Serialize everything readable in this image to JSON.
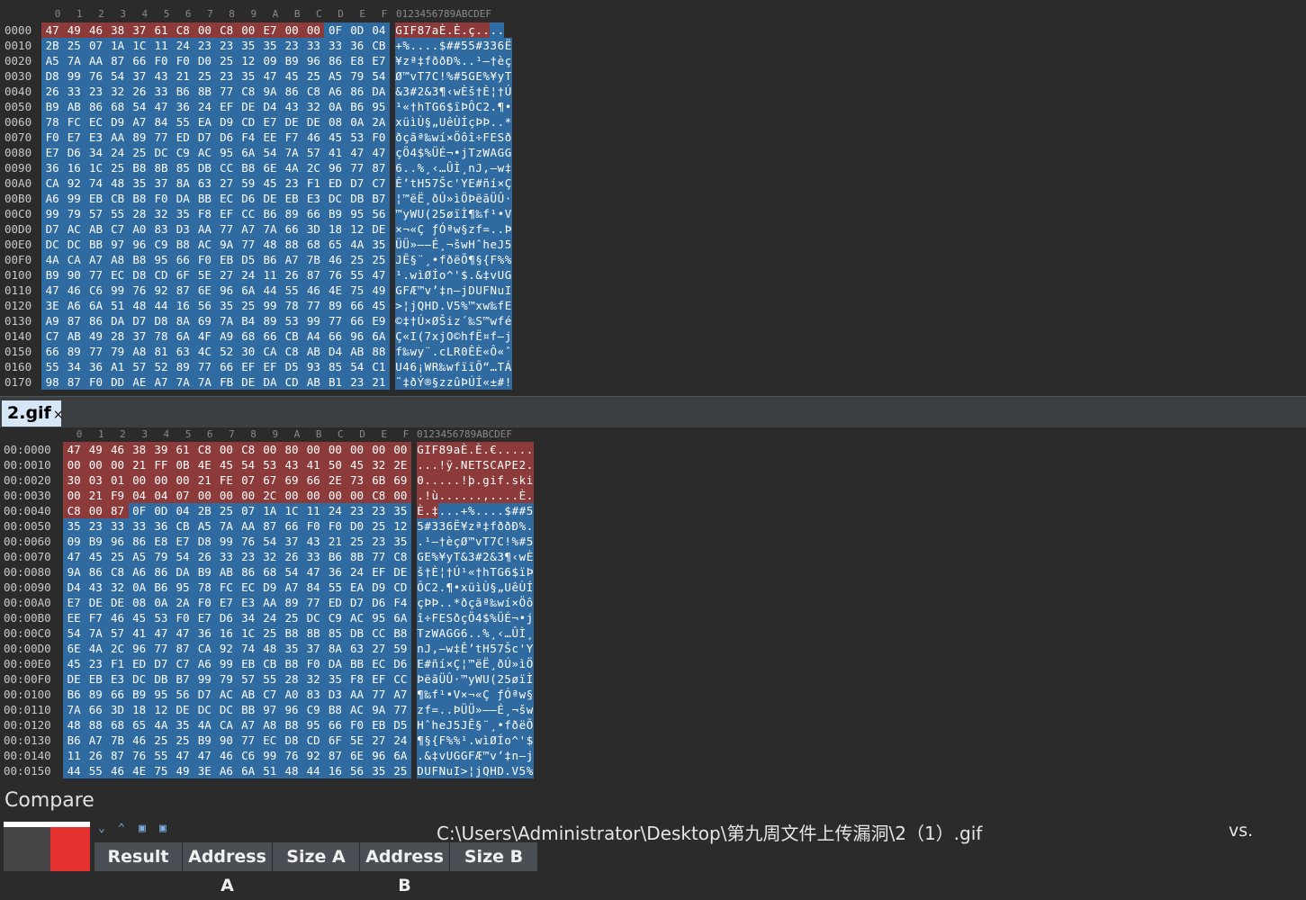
{
  "top_pane": {
    "col_header": "0 1 2 3 4 5 6 7 8 9 A B C D E F",
    "ascii_header": "0123456789ABCDEF",
    "rows": [
      {
        "off": "0000",
        "hex": "47 49 46 38 37 61 C8 00 C8 00 E7 00 00 0F 0D 04",
        "asc": "GIF87aÈ.È.ç....",
        "red": 13
      },
      {
        "off": "0010",
        "hex": "2B 25 07 1A 1C 11 24 23 23 35 35 23 33 33 36 CB",
        "asc": "+%....$##55#336Ë",
        "red": 0
      },
      {
        "off": "0020",
        "hex": "A5 7A AA 87 66 F0 F0 D0 25 12 09 B9 96 86 E8 E7",
        "asc": "¥zª‡fððÐ%..¹–†èç",
        "red": 0
      },
      {
        "off": "0030",
        "hex": "D8 99 76 54 37 43 21 25 23 35 47 45 25 A5 79 54",
        "asc": "Ø™vT7C!%#5GE%¥yT",
        "red": 0
      },
      {
        "off": "0040",
        "hex": "26 33 23 32 26 33 B6 8B 77 C8 9A 86 C8 A6 86 DA",
        "asc": "&3#2&3¶‹wÈš†È¦†Ú",
        "red": 0
      },
      {
        "off": "0050",
        "hex": "B9 AB 86 68 54 47 36 24 EF DE D4 43 32 0A B6 95",
        "asc": "¹«†hTG6$ïÞÔC2.¶•",
        "red": 0
      },
      {
        "off": "0060",
        "hex": "78 FC EC D9 A7 84 55 EA D9 CD E7 DE DE 08 0A 2A",
        "asc": "xüìÙ§„UêÙÍçÞÞ..*",
        "red": 0
      },
      {
        "off": "0070",
        "hex": "F0 E7 E3 AA 89 77 ED D7 D6 F4 EE F7 46 45 53 F0",
        "asc": "ðçãª‰wí×Öôî÷FESð",
        "red": 0
      },
      {
        "off": "0080",
        "hex": "E7 D6 34 24 25 DC C9 AC 95 6A 54 7A 57 41 47 47",
        "asc": "çÖ4$%ÜÉ¬•jTzWAGG",
        "red": 0
      },
      {
        "off": "0090",
        "hex": "36 16 1C 25 B8 8B 85 DB CC B8 6E 4A 2C 96 77 87",
        "asc": "6..%¸‹…ÛÌ¸nJ,–w‡",
        "red": 0
      },
      {
        "off": "00A0",
        "hex": "CA 92 74 48 35 37 8A 63 27 59 45 23 F1 ED D7 C7",
        "asc": "Ê’tH57Šc'YE#ñí×Ç",
        "red": 0
      },
      {
        "off": "00B0",
        "hex": "A6 99 EB CB B8 F0 DA BB EC D6 DE EB E3 DC DB B7",
        "asc": "¦™ëË¸ðÚ»ìÖÞëãÜÛ·",
        "red": 0
      },
      {
        "off": "00C0",
        "hex": "99 79 57 55 28 32 35 F8 EF CC B6 89 66 B9 95 56",
        "asc": "™yWU(25øïÌ¶‰f¹•V",
        "red": 0
      },
      {
        "off": "00D0",
        "hex": "D7 AC AB C7 A0 83 D3 AA 77 A7 7A 66 3D 18 12 DE",
        "asc": "×¬«Ç ƒÓªw§zf=..Þ",
        "red": 0
      },
      {
        "off": "00E0",
        "hex": "DC DC BB 97 96 C9 B8 AC 9A 77 48 88 68 65 4A 35",
        "asc": "ÜÜ»—–É¸¬šwHˆheJ5",
        "red": 0
      },
      {
        "off": "00F0",
        "hex": "4A CA A7 A8 B8 95 66 F0 EB D5 B6 A7 7B 46 25 25",
        "asc": "JÊ§¨¸•fðëÕ¶§{F%%",
        "red": 0
      },
      {
        "off": "0100",
        "hex": "B9 90 77 EC D8 CD 6F 5E 27 24 11 26 87 76 55 47",
        "asc": "¹.wìØÍo^'$.&‡vUG",
        "red": 0
      },
      {
        "off": "0110",
        "hex": "47 46 C6 99 76 92 87 6E 96 6A 44 55 46 4E 75 49",
        "asc": "GFÆ™v’‡n–jDUFNuI",
        "red": 0
      },
      {
        "off": "0120",
        "hex": "3E A6 6A 51 48 44 16 56 35 25 99 78 77 89 66 45",
        "asc": ">¦jQHD.V5%™xw‰fE",
        "red": 0
      },
      {
        "off": "0130",
        "hex": "A9 87 86 DA D7 D8 8A 69 7A B4 89 53 99 77 66 E9",
        "asc": "©‡†Ú×ØŠiz´‰S™wfé",
        "red": 0
      },
      {
        "off": "0140",
        "hex": "C7 AB 49 28 37 78 6A 4F A9 68 66 CB A4 66 96 6A",
        "asc": "Ç«I(7xjO©hfË¤f–j",
        "red": 0
      },
      {
        "off": "0150",
        "hex": "66 89 77 79 A8 81 63 4C 52 30 CA C8 AB D4 AB 88",
        "asc": "f‰wy¨.cLR0ÊÈ«Ô«ˆ",
        "red": 0
      },
      {
        "off": "0160",
        "hex": "55 34 36 A1 57 52 89 77 66 EF EF D5 93 85 54 C1",
        "asc": "U46¡WR‰wfïïÕ“…TÁ",
        "red": 0
      },
      {
        "off": "0170",
        "hex": "98 87 F0 DD AE A7 7A 7A FB DE DA CD AB B1 23 21",
        "asc": "˜‡ðÝ®§zzûÞÚÍ«±#!",
        "red": 0
      }
    ]
  },
  "tab": {
    "label": "2.gif",
    "close": "×"
  },
  "bottom_pane": {
    "col_header": "0 1 2 3 4 5 6 7 8 9 A B C D E F",
    "ascii_header": "0123456789ABCDEF",
    "rows": [
      {
        "off": "00:0000",
        "hex": "47 49 46 38 39 61 C8 00 C8 00 80 00 00 00 00 00",
        "asc": "GIF89aÈ.È.€.....",
        "red": 16
      },
      {
        "off": "00:0010",
        "hex": "00 00 00 21 FF 0B 4E 45 54 53 43 41 50 45 32 2E",
        "asc": "...!ÿ.NETSCAPE2.",
        "red": 16
      },
      {
        "off": "00:0020",
        "hex": "30 03 01 00 00 00 21 FE 07 67 69 66 2E 73 6B 69",
        "asc": "0.....!þ.gif.ski",
        "red": 16
      },
      {
        "off": "00:0030",
        "hex": "00 21 F9 04 04 07 00 00 00 2C 00 00 00 00 C8 00",
        "asc": ".!ù......,....È.",
        "red": 16
      },
      {
        "off": "00:0040",
        "hex": "C8 00 87 0F 0D 04 2B 25 07 1A 1C 11 24 23 23 35",
        "asc": "È.‡...+%....$##5",
        "red": 3
      },
      {
        "off": "00:0050",
        "hex": "35 23 33 33 36 CB A5 7A AA 87 66 F0 F0 D0 25 12",
        "asc": "5#336Ë¥zª‡fððÐ%.",
        "red": 0
      },
      {
        "off": "00:0060",
        "hex": "09 B9 96 86 E8 E7 D8 99 76 54 37 43 21 25 23 35",
        "asc": ".¹–†èçØ™vT7C!%#5",
        "red": 0
      },
      {
        "off": "00:0070",
        "hex": "47 45 25 A5 79 54 26 33 23 32 26 33 B6 8B 77 C8",
        "asc": "GE%¥yT&3#2&3¶‹wÈ",
        "red": 0
      },
      {
        "off": "00:0080",
        "hex": "9A 86 C8 A6 86 DA B9 AB 86 68 54 47 36 24 EF DE",
        "asc": "š†È¦†Ú¹«†hTG6$ïÞ",
        "red": 0
      },
      {
        "off": "00:0090",
        "hex": "D4 43 32 0A B6 95 78 FC EC D9 A7 84 55 EA D9 CD",
        "asc": "ÔC2.¶•xüìÙ§„UêÙÍ",
        "red": 0
      },
      {
        "off": "00:00A0",
        "hex": "E7 DE DE 08 0A 2A F0 E7 E3 AA 89 77 ED D7 D6 F4",
        "asc": "çÞÞ..*ðçãª‰wí×Öô",
        "red": 0
      },
      {
        "off": "00:00B0",
        "hex": "EE F7 46 45 53 F0 E7 D6 34 24 25 DC C9 AC 95 6A",
        "asc": "î÷FESðçÖ4$%ÜÉ¬•j",
        "red": 0
      },
      {
        "off": "00:00C0",
        "hex": "54 7A 57 41 47 47 36 16 1C 25 B8 8B 85 DB CC B8",
        "asc": "TzWAGG6..%¸‹…ÛÌ¸",
        "red": 0
      },
      {
        "off": "00:00D0",
        "hex": "6E 4A 2C 96 77 87 CA 92 74 48 35 37 8A 63 27 59",
        "asc": "nJ,–w‡Ê’tH57Šc'Y",
        "red": 0
      },
      {
        "off": "00:00E0",
        "hex": "45 23 F1 ED D7 C7 A6 99 EB CB B8 F0 DA BB EC D6",
        "asc": "E#ñí×Ç¦™ëË¸ðÚ»ìÖ",
        "red": 0
      },
      {
        "off": "00:00F0",
        "hex": "DE EB E3 DC DB B7 99 79 57 55 28 32 35 F8 EF CC",
        "asc": "ÞëãÜÛ·™yWU(25øïÌ",
        "red": 0
      },
      {
        "off": "00:0100",
        "hex": "B6 89 66 B9 95 56 D7 AC AB C7 A0 83 D3 AA 77 A7",
        "asc": "¶‰f¹•V×¬«Ç ƒÓªw§",
        "red": 0
      },
      {
        "off": "00:0110",
        "hex": "7A 66 3D 18 12 DE DC DC BB 97 96 C9 B8 AC 9A 77",
        "asc": "zf=..ÞÜÜ»—–É¸¬šw",
        "red": 0
      },
      {
        "off": "00:0120",
        "hex": "48 88 68 65 4A 35 4A CA A7 A8 B8 95 66 F0 EB D5",
        "asc": "HˆheJ5JÊ§¨¸•fðëÕ",
        "red": 0
      },
      {
        "off": "00:0130",
        "hex": "B6 A7 7B 46 25 25 B9 90 77 EC D8 CD 6F 5E 27 24",
        "asc": "¶§{F%%¹.wìØÍo^'$",
        "red": 0
      },
      {
        "off": "00:0140",
        "hex": "11 26 87 76 55 47 47 46 C6 99 76 92 87 6E 96 6A",
        "asc": ".&‡vUGGFÆ™v’‡n–j",
        "red": 0
      },
      {
        "off": "00:0150",
        "hex": "44 55 46 4E 75 49 3E A6 6A 51 48 44 16 56 35 25",
        "asc": "DUFNuI>¦jQHD.V5%",
        "red": 0
      }
    ]
  },
  "compare": {
    "title": "Compare",
    "path": "C:\\Users\\Administrator\\Desktop\\第九周文件上传漏洞\\2（1）.gif",
    "vs": "vs.",
    "columns": [
      "Result",
      "Address A",
      "Size A",
      "Address B",
      "Size B"
    ],
    "controls": {
      "next": "⌄",
      "prev": "⌃"
    }
  },
  "colors": {
    "red": "#8c3a3a",
    "blue": "#2f6aa0",
    "bg": "#2b2b2b"
  }
}
